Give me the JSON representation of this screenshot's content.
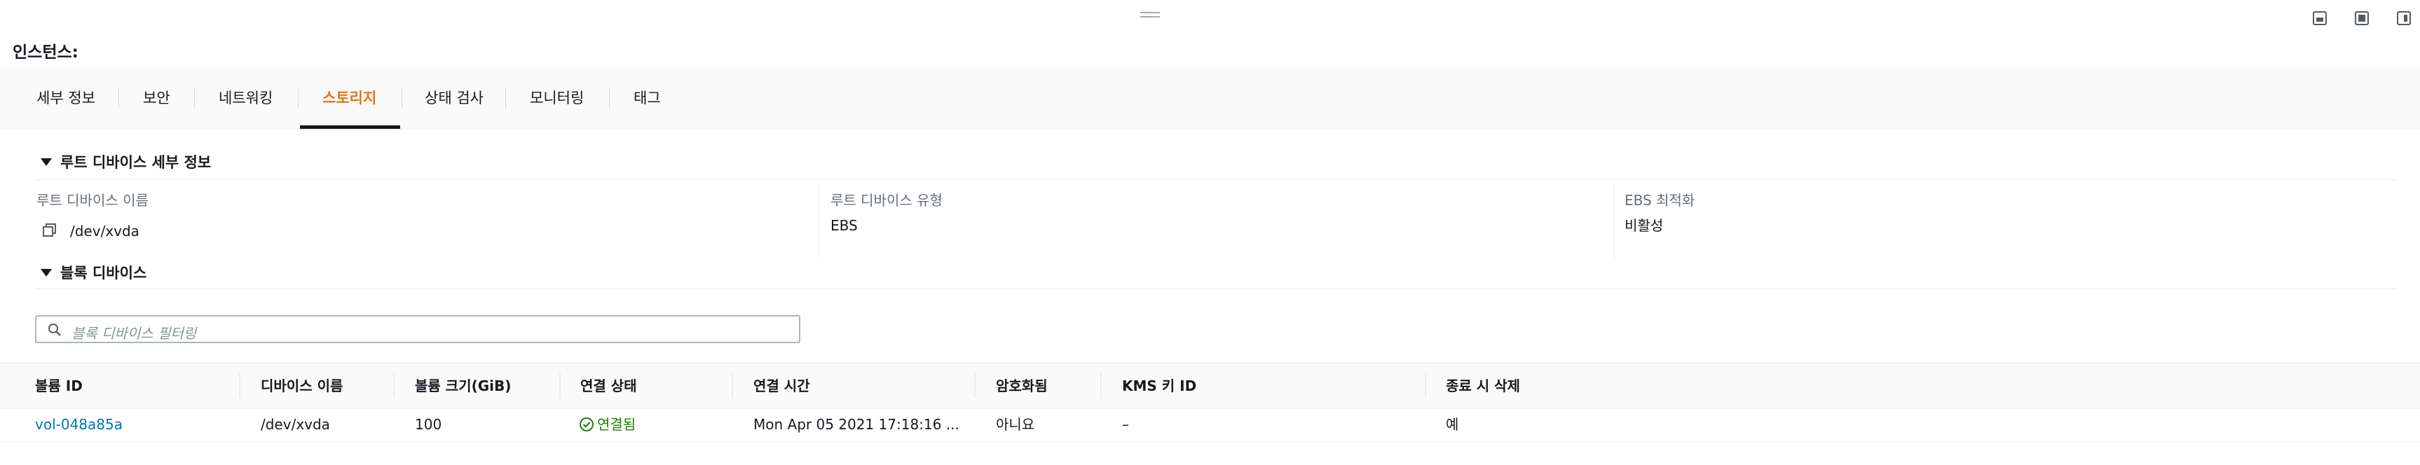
{
  "window": {
    "controls": [
      {
        "name": "dock-bottom-icon"
      },
      {
        "name": "dock-middle-icon"
      },
      {
        "name": "dock-side-icon"
      }
    ]
  },
  "header": {
    "title": "인스턴스:"
  },
  "tabs": [
    {
      "label": "세부 정보",
      "active": false
    },
    {
      "label": "보안",
      "active": false
    },
    {
      "label": "네트워킹",
      "active": false
    },
    {
      "label": "스토리지",
      "active": true
    },
    {
      "label": "상태 검사",
      "active": false
    },
    {
      "label": "모니터링",
      "active": false
    },
    {
      "label": "태그",
      "active": false
    }
  ],
  "root_device": {
    "section_title": "루트 디바이스 세부 정보",
    "name_label": "루트 디바이스 이름",
    "name_value": "/dev/xvda",
    "type_label": "루트 디바이스 유형",
    "type_value": "EBS",
    "ebs_opt_label": "EBS 최적화",
    "ebs_opt_value": "비활성"
  },
  "block_devices": {
    "section_title": "블록 디바이스",
    "filter_placeholder": "블록 디바이스 필터링",
    "columns": [
      "볼륨 ID",
      "디바이스 이름",
      "볼륨 크기(GiB)",
      "연결 상태",
      "연결 시간",
      "암호화됨",
      "KMS 키 ID",
      "종료 시 삭제"
    ],
    "rows": [
      {
        "volume_id": "vol-048a85a",
        "device_name": "/dev/xvda",
        "size": "100",
        "attach_status": "연결됨",
        "attach_time": "Mon Apr 05 2021 17:18:16 ...",
        "encrypted": "아니요",
        "kms_key": "–",
        "delete_on_termination": "예"
      }
    ]
  },
  "colors": {
    "accent": "#ec7211",
    "link": "#0073bb",
    "success": "#1d8102"
  }
}
